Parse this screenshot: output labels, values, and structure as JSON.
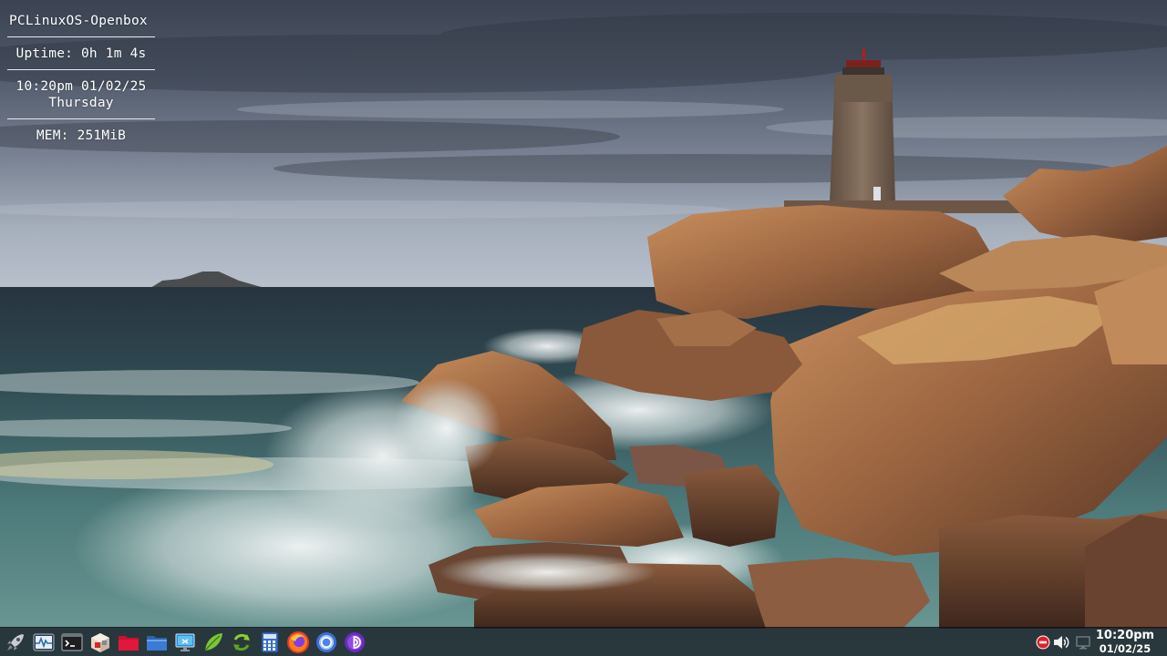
{
  "desktop": {
    "wallpaper": "lighthouse-coast-photo"
  },
  "conky": {
    "title": "PCLinuxOS-Openbox",
    "uptime": "Uptime: 0h 1m 4s",
    "datetime": "10:20pm  01/02/25",
    "weekday": "Thursday",
    "memory": "MEM: 251MiB"
  },
  "taskbar": {
    "launchers": [
      {
        "name": "menu",
        "icon": "rocket-icon"
      },
      {
        "name": "system-monitor",
        "icon": "system-monitor-icon"
      },
      {
        "name": "terminal",
        "icon": "terminal-icon"
      },
      {
        "name": "package-manager",
        "icon": "package-icon"
      },
      {
        "name": "red-folder",
        "icon": "red-folder-icon"
      },
      {
        "name": "file-manager",
        "icon": "folder-icon"
      },
      {
        "name": "display-settings",
        "icon": "monitor-icon"
      },
      {
        "name": "text-editor",
        "icon": "leaf-icon"
      },
      {
        "name": "updater",
        "icon": "sync-icon"
      },
      {
        "name": "calculator",
        "icon": "calculator-icon"
      },
      {
        "name": "firefox",
        "icon": "firefox-icon"
      },
      {
        "name": "chromium",
        "icon": "chromium-icon"
      },
      {
        "name": "media-player",
        "icon": "media-player-icon"
      }
    ],
    "tray": [
      {
        "name": "network-status",
        "icon": "no-network-icon"
      },
      {
        "name": "volume",
        "icon": "speaker-icon"
      },
      {
        "name": "display",
        "icon": "display-icon"
      }
    ],
    "clock": {
      "time": "10:20pm",
      "date": "01/02/25"
    }
  },
  "colors": {
    "taskbar_bg": "#161c24",
    "conky_text": "#ffffff",
    "red_folder": "#e3173c",
    "calendar_blue": "#3a6fc4",
    "leaf_green": "#7cc43a"
  }
}
